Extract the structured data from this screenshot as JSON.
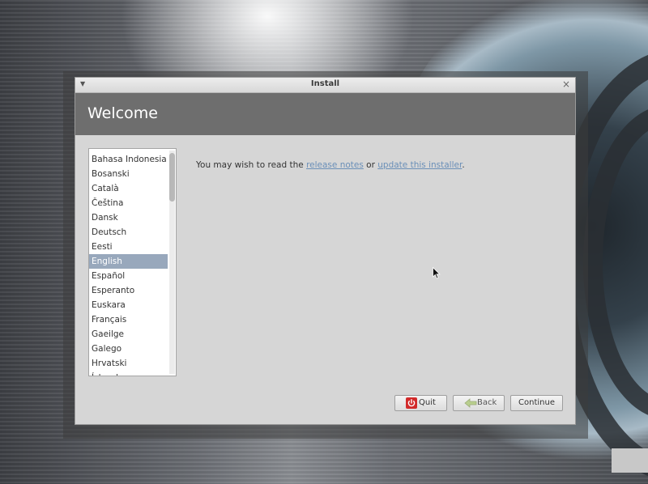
{
  "window": {
    "title": "Install"
  },
  "header": {
    "title": "Welcome"
  },
  "languages": {
    "items": [
      "Bahasa Indonesia",
      "Bosanski",
      "Català",
      "Čeština",
      "Dansk",
      "Deutsch",
      "Eesti",
      "English",
      "Español",
      "Esperanto",
      "Euskara",
      "Français",
      "Gaeilge",
      "Galego",
      "Hrvatski",
      "Íslenska"
    ],
    "selected": "English"
  },
  "info": {
    "prefix": "You may wish to read the ",
    "link1": "release notes",
    "middle": " or ",
    "link2": "update this installer",
    "suffix": "."
  },
  "buttons": {
    "quit": "Quit",
    "back": "Back",
    "continue": "Continue"
  },
  "icons": {
    "menu": "dropdown-arrow-icon",
    "close": "close-icon",
    "quit": "power-icon",
    "back": "arrow-left-icon"
  },
  "colors": {
    "header_band": "#6e6e6e",
    "selection": "#98a8bc",
    "link": "#6a8fb8",
    "quit_icon": "#d22a2a"
  }
}
